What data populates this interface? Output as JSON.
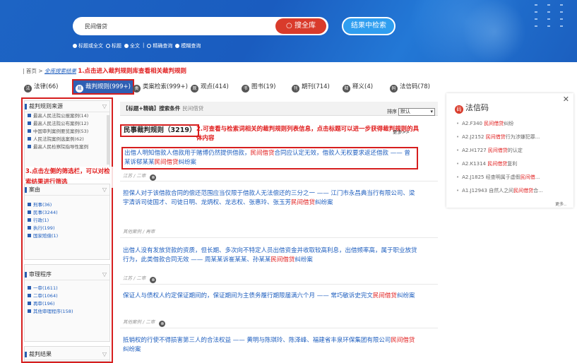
{
  "search": {
    "query": "民间借贷",
    "search_btn": "搜全库",
    "refine_btn": "结果中检索",
    "options": [
      "标题或全文",
      "标题",
      "全文",
      "精确查询",
      "模糊查询"
    ],
    "sep": "|"
  },
  "breadcrumb": {
    "home": "首页",
    "sep": " > ",
    "link": "全库搜索结果",
    "annotation": "1.点击进入裁判规则库查看相关裁判规则"
  },
  "tabs": [
    {
      "label": "法律(66)",
      "icon": "法"
    },
    {
      "label": "裁判规则(999+)",
      "icon": "裁"
    },
    {
      "label": "类案检索(999+)",
      "icon": "类"
    },
    {
      "label": "观点(414)",
      "icon": "观"
    },
    {
      "label": "图书(19)",
      "icon": "书"
    },
    {
      "label": "期刊(714)",
      "icon": "刊"
    },
    {
      "label": "释义(4)",
      "icon": "释"
    },
    {
      "label": "法信码(78)",
      "icon": "码"
    }
  ],
  "sidebar": {
    "source_title": "裁判规则来源",
    "sources": [
      "最高人民法院公报案例(14)",
      "最高人民法院公布案例(12)",
      "中国审判案例要览案例(53)",
      "人民法院案例选案例(62)",
      "最高人民检察院指导性案例"
    ],
    "case_title": "案由",
    "cases": [
      "刑事(36)",
      "民事(3244)",
      "行政(1)",
      "执行(199)",
      "国家赔偿(1)"
    ],
    "trial_title": "审理程序",
    "trials": [
      "一审(1611)",
      "二审(1064)",
      "再审(196)",
      "其他审理程序(158)"
    ],
    "result_title": "裁判结果",
    "annotation": "3.点击左侧的筛选栏，可以对检索结果进行筛选"
  },
  "main": {
    "cond_label": "【标题+精确】搜索条件",
    "cond_query": "民间借贷",
    "sort_label": "排序",
    "sort_value": "默认",
    "result_title": "民事裁判规则（3219）",
    "annotation": "2.可查看与检索词相关的裁判规则列表信息，点击标题可以进一步获得裁判规则的具体内容",
    "more": "更多>>"
  },
  "results": [
    {
      "pre": "出借人明知借款人借款用于赌博仍然提供借款，",
      "kw": "民间借贷",
      "post": "合同应认定无效，借款人无权要求返还借款 —— 曾某诉郁某某",
      "kw2": "民间借贷",
      "post2": "纠纷案",
      "meta": "江苏 / 二审"
    },
    {
      "pre": "担保人对于该借款合同的偿还范围应当仅限于借款人无法偿还的三分之一 —— 江门市永昌典当行有限公司、梁宇清诉司徒国才、司徒日明、龙炳权、龙志权、张惠玲、张玉芳",
      "kw": "民间借贷",
      "post": "纠纷案",
      "kw2": "",
      "post2": "",
      "meta": "其他案例 / 再审"
    },
    {
      "pre": "出借人没有发放贷款的资质，但长期、多次向不特定人员出借资金并收取较高利息，出借频率高，属于职业放贷行为，此类借款合同无效 —— 周某某诉崔某某、孙某某",
      "kw": "民间借贷",
      "post": "纠纷案",
      "kw2": "",
      "post2": "",
      "meta": "江苏 / 二审"
    },
    {
      "pre": "保证人与债权人约定保证期间的，保证期间为主债务履行期限届满六个月 —— 常巧敏诉史完文",
      "kw": "民间借贷",
      "post": "纠纷案",
      "kw2": "",
      "post2": "",
      "meta": "其他案例 / 二审"
    },
    {
      "pre": "抵销权的行使不得损害第三人的合法权益 —— 黄明与陈琪玲、陈泽峰、福建省丰泉环保集团有限公司",
      "kw": "民间借贷",
      "post": "纠纷案",
      "kw2": "",
      "post2": "",
      "meta": ""
    }
  ],
  "faxin": {
    "title": "法信码",
    "items": [
      {
        "code": "A2.F340",
        "kw": "民间借贷",
        "post": "纠纷"
      },
      {
        "code": "A2.J2152",
        "kw": "民间借贷",
        "post": "行为涉嫌犯罪..."
      },
      {
        "code": "A2.H1727",
        "kw": "民间借贷",
        "post": "的认定"
      },
      {
        "code": "A2.K1314",
        "kw": "民间借贷",
        "post": "复利"
      },
      {
        "code": "A2.J1825 经查明属于虚假",
        "kw": "民间借",
        "post": "..."
      },
      {
        "code": "A1.J12943 自然人之间",
        "kw": "民间借贷",
        "post": "合..."
      }
    ],
    "more": "更多.."
  }
}
